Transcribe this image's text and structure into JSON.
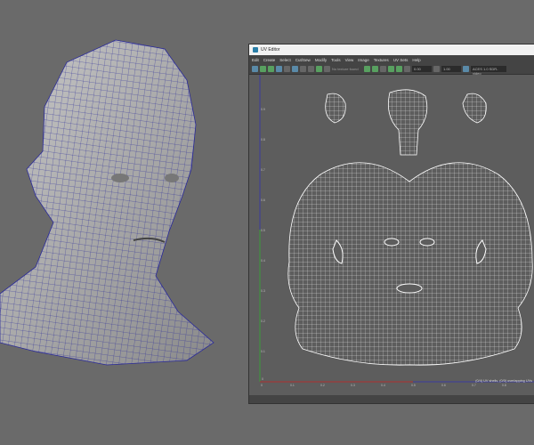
{
  "window": {
    "title": "UV Editor",
    "icon": "uv-editor-icon"
  },
  "menu": [
    "Edit",
    "Create",
    "Select",
    "Cut/Sew",
    "Modify",
    "Tools",
    "View",
    "Image",
    "Textures",
    "UV Sets",
    "Help"
  ],
  "toolbar": {
    "texture_placeholder": "No texture found",
    "field1": "0.00",
    "field2": "1.00",
    "colorspace": "ACES 1.0 SDR-video"
  },
  "axes": {
    "u_ticks": [
      "0",
      "0.1",
      "0.2",
      "0.3",
      "0.4",
      "0.5",
      "0.6",
      "0.7",
      "0.8"
    ],
    "v_ticks": [
      "0.9",
      "0.8",
      "0.7",
      "0.6",
      "0.5",
      "0.4",
      "0.3",
      "0.2",
      "0.1",
      "0"
    ]
  },
  "status": "(0/4) UV shells, (0/0) overlapping UVs",
  "colors": {
    "background": "#6a6a6a",
    "mesh_wire": "#2a2a9a",
    "uv_wire": "#ffffff",
    "u_axis": "#b03030",
    "v_axis": "#3a9a3a"
  }
}
